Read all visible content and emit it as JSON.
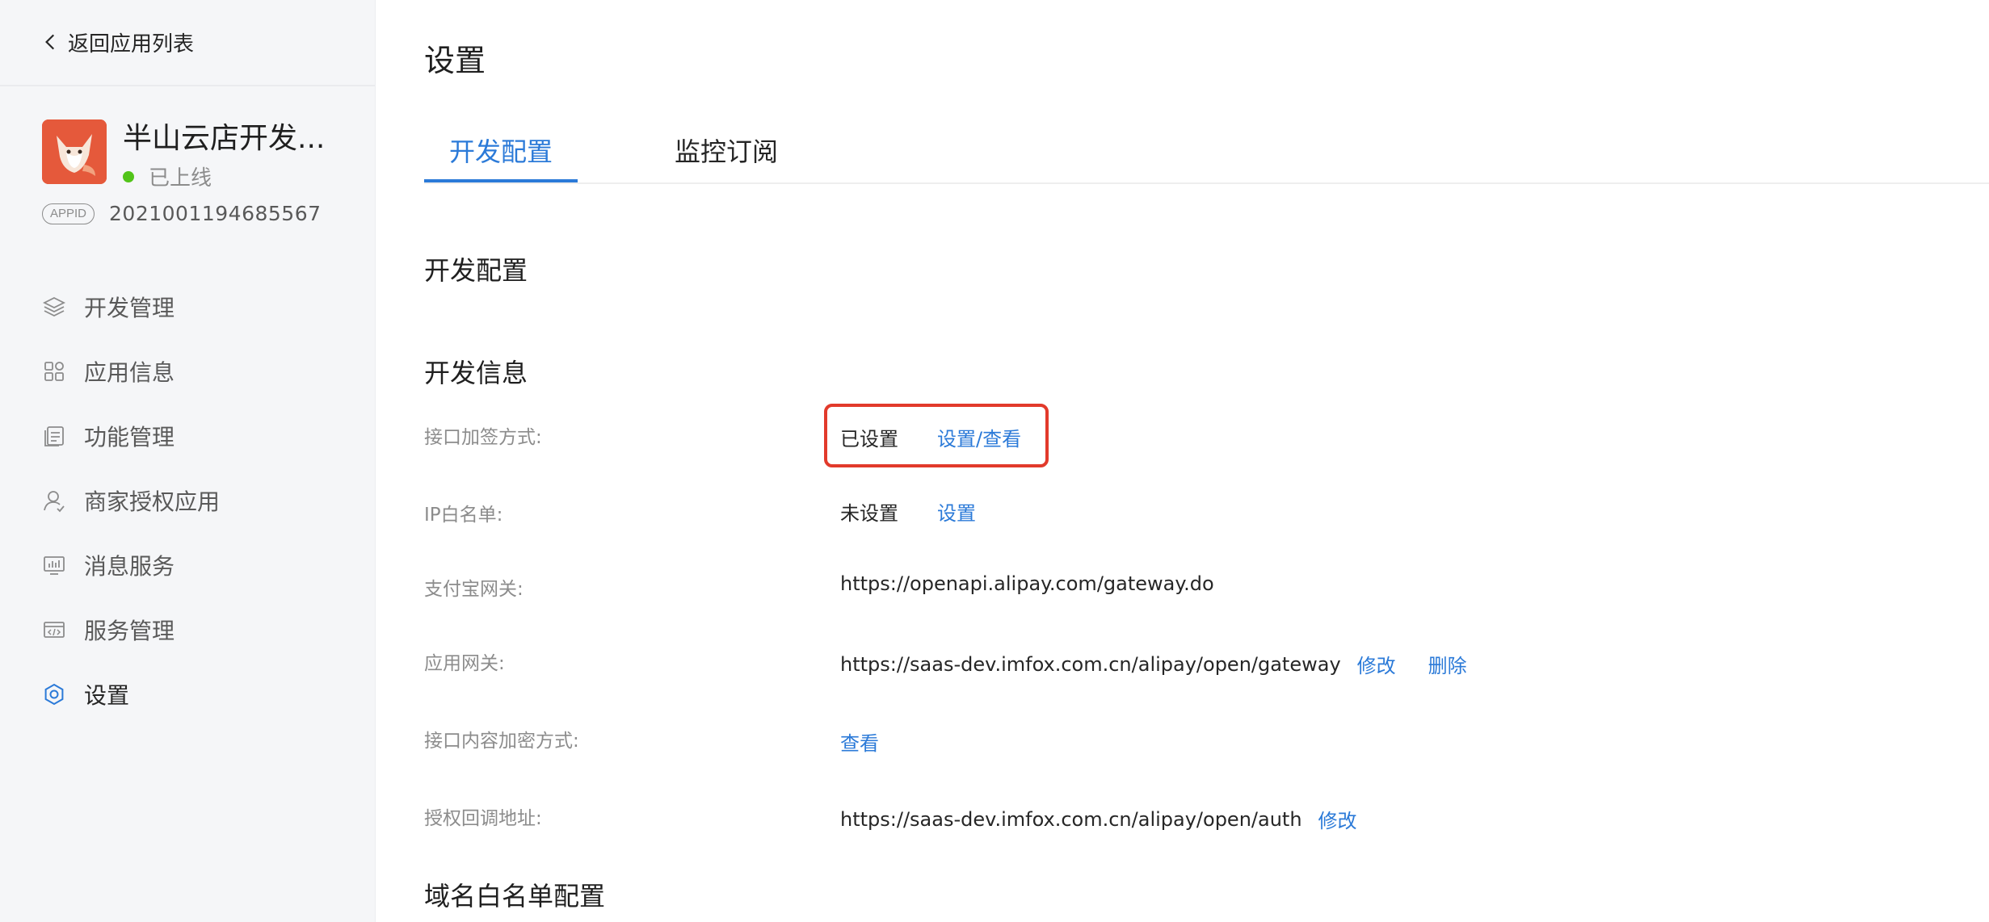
{
  "sidebar": {
    "back_label": "返回应用列表",
    "app": {
      "name": "半山云店开发...",
      "status": "已上线",
      "status_color": "#52c41a",
      "appid_badge": "APPID",
      "appid": "2021001194685567"
    },
    "items": [
      {
        "label": "开发管理",
        "icon": "layers-icon"
      },
      {
        "label": "应用信息",
        "icon": "apps-grid-icon"
      },
      {
        "label": "功能管理",
        "icon": "document-stack-icon"
      },
      {
        "label": "商家授权应用",
        "icon": "user-auth-icon"
      },
      {
        "label": "消息服务",
        "icon": "monitor-chart-icon"
      },
      {
        "label": "服务管理",
        "icon": "card-code-icon"
      },
      {
        "label": "设置",
        "icon": "gear-icon",
        "active": true
      }
    ]
  },
  "main": {
    "title": "设置",
    "tabs": [
      {
        "label": "开发配置",
        "active": true
      },
      {
        "label": "监控订阅"
      }
    ],
    "section_title": "开发配置",
    "dev_info_title": "开发信息",
    "rows": {
      "sign": {
        "label": "接口加签方式:",
        "value": "已设置",
        "action": "设置/查看"
      },
      "ip": {
        "label": "IP白名单:",
        "value": "未设置",
        "action": "设置"
      },
      "alipay_gateway": {
        "label": "支付宝网关:",
        "value": "https://openapi.alipay.com/gateway.do"
      },
      "app_gateway": {
        "label": "应用网关:",
        "value": "https://saas-dev.imfox.com.cn/alipay/open/gateway",
        "edit": "修改",
        "delete": "删除"
      },
      "encrypt": {
        "label": "接口内容加密方式:",
        "action": "查看"
      },
      "auth_callback": {
        "label": "授权回调地址:",
        "value": "https://saas-dev.imfox.com.cn/alipay/open/auth",
        "edit": "修改"
      }
    },
    "domain_whitelist_title": "域名白名单配置"
  },
  "colors": {
    "accent": "#2b7ad8",
    "highlight": "#e23a2b",
    "logo_bg": "#e5593b"
  }
}
